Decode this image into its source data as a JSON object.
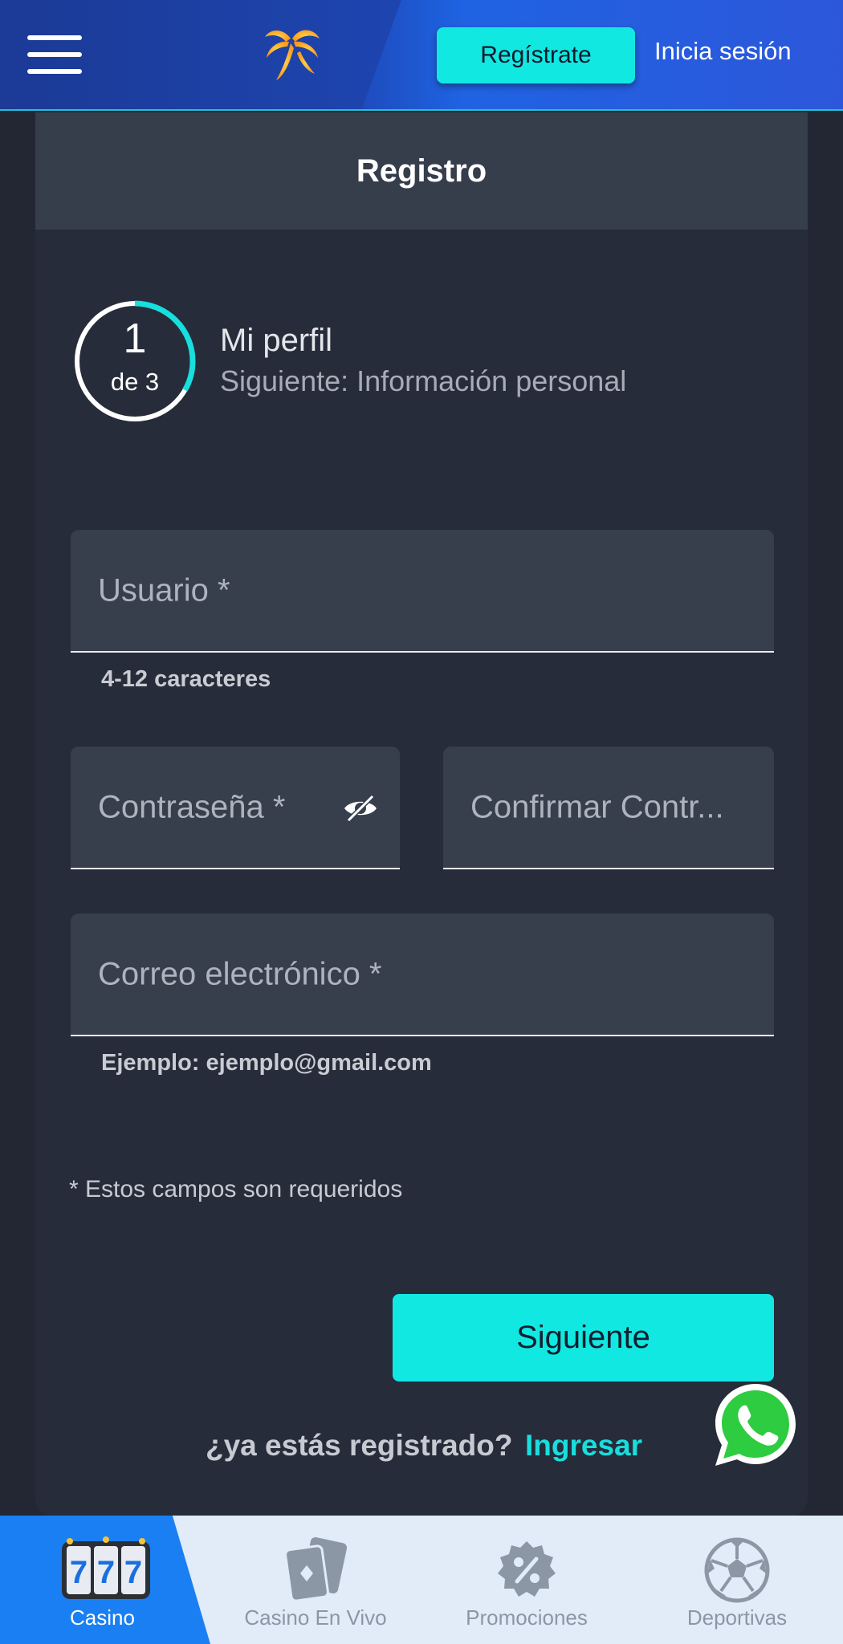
{
  "header": {
    "register_label": "Regístrate",
    "login_label": "Inicia sesión"
  },
  "card": {
    "title": "Registro"
  },
  "steps": {
    "current": "1",
    "of_label": "de 3",
    "progress_fraction": 0.3333,
    "title": "Mi perfil",
    "next": "Siguiente: Información personal"
  },
  "form": {
    "username_label": "Usuario *",
    "username_hint": "4-12 caracteres",
    "password_label": "Contraseña *",
    "confirm_label": "Confirmar Contr...",
    "email_label": "Correo electrónico *",
    "email_hint": "Ejemplo: ejemplo@gmail.com",
    "required_note": "* Estos campos son requeridos",
    "next_button": "Siguiente",
    "already_registered": "¿ya estás registrado?",
    "login_link": "Ingresar"
  },
  "bottom_nav": {
    "items": [
      {
        "label": "Casino",
        "icon": "slot-777-icon",
        "active": true
      },
      {
        "label": "Casino En Vivo",
        "icon": "cards-icon",
        "active": false
      },
      {
        "label": "Promociones",
        "icon": "percent-badge-icon",
        "active": false
      },
      {
        "label": "Deportivas",
        "icon": "soccer-ball-icon",
        "active": false
      }
    ]
  },
  "colors": {
    "accent": "#12e8e2",
    "header_blue": "#1d46b4",
    "card_bg": "#262c39",
    "field_bg": "#373e4c",
    "nav_active": "#1a7ff2",
    "whatsapp_green": "#2ecc40"
  }
}
